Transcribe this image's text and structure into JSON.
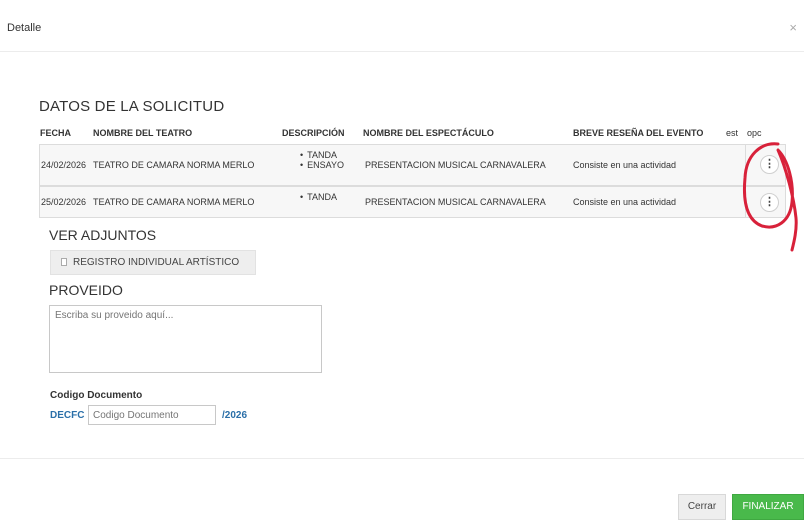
{
  "modal": {
    "title": "Detalle",
    "close": "×"
  },
  "datos": {
    "title": "DATOS DE LA SOLICITUD",
    "headers": {
      "fecha": "FECHA",
      "teatro": "NOMBRE DEL TEATRO",
      "descripcion": "DESCRIPCIÓN",
      "espectaculo": "NOMBRE DEL ESPECTÁCULO",
      "resena": "BREVE RESEÑA DEL EVENTO",
      "est": "est",
      "opc": "opc"
    },
    "rows": [
      {
        "fecha": "24/02/2026",
        "teatro": "TEATRO DE CAMARA NORMA MERLO",
        "descripcion": [
          "TANDA",
          "ENSAYO"
        ],
        "espectaculo": "PRESENTACION MUSICAL CARNAVALERA",
        "resena": "Consiste en una actividad",
        "opc_icon": "vertical-dots-icon"
      },
      {
        "fecha": "25/02/2026",
        "teatro": "TEATRO DE CAMARA NORMA MERLO",
        "descripcion": [
          "TANDA"
        ],
        "espectaculo": "PRESENTACION MUSICAL CARNAVALERA",
        "resena": "Consiste en una actividad",
        "opc_icon": "vertical-dots-icon"
      }
    ]
  },
  "adjuntos": {
    "title": "VER ADJUNTOS",
    "item": "REGISTRO INDIVIDUAL ARTÍSTICO"
  },
  "proveido": {
    "title": "PROVEIDO",
    "placeholder": "Escriba su proveido aquí..."
  },
  "codigo": {
    "label": "Codigo Documento",
    "prefix": "DECFC",
    "placeholder": "Codigo Documento",
    "suffix": "/2026"
  },
  "footer": {
    "cerrar": "Cerrar",
    "finalizar": "FINALIZAR"
  },
  "colors": {
    "accent_blue": "#2a6fa8",
    "success_green": "#49b94b",
    "annotation_red": "#d8213a"
  }
}
